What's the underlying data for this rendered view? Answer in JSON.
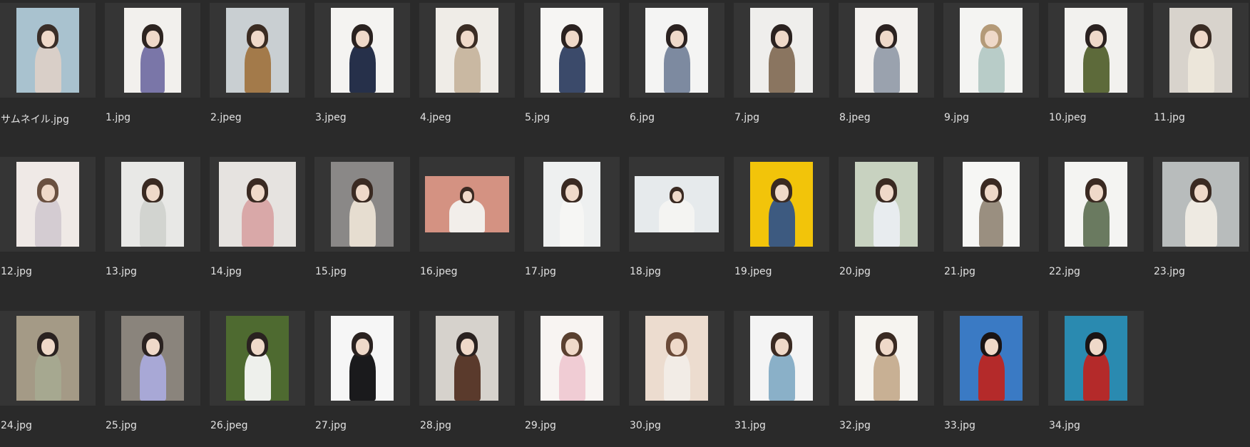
{
  "files": [
    {
      "name": "サムネイル.jpg",
      "orient": "p",
      "bg": "#a9c2cf",
      "fg": "#d9cfc8",
      "hair": "#3a2e28"
    },
    {
      "name": "1.jpg",
      "orient": "ps",
      "bg": "#f2f0ed",
      "fg": "#7a76a8",
      "hair": "#2d2420"
    },
    {
      "name": "2.jpeg",
      "orient": "p",
      "bg": "#c9cfd2",
      "fg": "#a37a4a",
      "hair": "#3b2c22"
    },
    {
      "name": "3.jpeg",
      "orient": "p",
      "bg": "#f4f3f1",
      "fg": "#26304a",
      "hair": "#2a2220"
    },
    {
      "name": "4.jpeg",
      "orient": "p",
      "bg": "#efece7",
      "fg": "#c9b8a2",
      "hair": "#3a2c24"
    },
    {
      "name": "5.jpg",
      "orient": "p",
      "bg": "#f6f5f3",
      "fg": "#3b4a6a",
      "hair": "#2b2220"
    },
    {
      "name": "6.jpg",
      "orient": "p",
      "bg": "#f4f4f3",
      "fg": "#7d8aa0",
      "hair": "#2b2220"
    },
    {
      "name": "7.jpg",
      "orient": "p",
      "bg": "#efeeec",
      "fg": "#8a7560",
      "hair": "#2b2220"
    },
    {
      "name": "8.jpeg",
      "orient": "p",
      "bg": "#f3f1ee",
      "fg": "#9aa2ae",
      "hair": "#2b2220"
    },
    {
      "name": "9.jpg",
      "orient": "p",
      "bg": "#f4f4f2",
      "fg": "#b8ccc8",
      "hair": "#b49a78"
    },
    {
      "name": "10.jpeg",
      "orient": "p",
      "bg": "#f2f1ee",
      "fg": "#5d6a3a",
      "hair": "#2b2220"
    },
    {
      "name": "11.jpg",
      "orient": "p",
      "bg": "#d8d3cc",
      "fg": "#ece6da",
      "hair": "#3a2c24"
    },
    {
      "name": "12.jpg",
      "orient": "p",
      "bg": "#efe9e6",
      "fg": "#d4ccd2",
      "hair": "#6a5040"
    },
    {
      "name": "13.jpg",
      "orient": "p",
      "bg": "#e8e8e6",
      "fg": "#d2d4d0",
      "hair": "#3a2a22"
    },
    {
      "name": "14.jpg",
      "orient": "l",
      "bg": "#e6e3e0",
      "fg": "#d9a8a8",
      "hair": "#3a2a22"
    },
    {
      "name": "15.jpg",
      "orient": "p",
      "bg": "#8a8887",
      "fg": "#e6ddd0",
      "hair": "#3a2a22"
    },
    {
      "name": "16.jpeg",
      "orient": "w",
      "bg": "#d49282",
      "fg": "#f2eeea",
      "hair": "#3a2a22"
    },
    {
      "name": "17.jpg",
      "orient": "ps",
      "bg": "#eef0f0",
      "fg": "#f6f6f4",
      "hair": "#3a2a22"
    },
    {
      "name": "18.jpg",
      "orient": "w",
      "bg": "#e6eaec",
      "fg": "#f4f4f2",
      "hair": "#3a2a22"
    },
    {
      "name": "19.jpeg",
      "orient": "p",
      "bg": "#f2c40a",
      "fg": "#3d5a80",
      "hair": "#3a2a22"
    },
    {
      "name": "20.jpg",
      "orient": "p",
      "bg": "#c8d2c0",
      "fg": "#e8ecef",
      "hair": "#3a2a22"
    },
    {
      "name": "21.jpg",
      "orient": "ps",
      "bg": "#f6f6f4",
      "fg": "#9a8f80",
      "hair": "#3a2a22"
    },
    {
      "name": "22.jpg",
      "orient": "p",
      "bg": "#f4f4f2",
      "fg": "#6a7a60",
      "hair": "#3a2a22"
    },
    {
      "name": "23.jpg",
      "orient": "l",
      "bg": "#b8bcbc",
      "fg": "#eeeae2",
      "hair": "#3a2a22"
    },
    {
      "name": "24.jpg",
      "orient": "p",
      "bg": "#a49a86",
      "fg": "#a6a890",
      "hair": "#2a2220"
    },
    {
      "name": "25.jpg",
      "orient": "p",
      "bg": "#8a847c",
      "fg": "#a8a8d6",
      "hair": "#2a2220"
    },
    {
      "name": "26.jpeg",
      "orient": "p",
      "bg": "#4e6a30",
      "fg": "#eef0ec",
      "hair": "#2a2220"
    },
    {
      "name": "27.jpg",
      "orient": "p",
      "bg": "#f6f6f6",
      "fg": "#1a1a1c",
      "hair": "#2a2220"
    },
    {
      "name": "28.jpg",
      "orient": "p",
      "bg": "#d6d2cc",
      "fg": "#5a3a2c",
      "hair": "#2a2220"
    },
    {
      "name": "29.jpg",
      "orient": "p",
      "bg": "#f8f4f2",
      "fg": "#f0ccd4",
      "hair": "#5a4030"
    },
    {
      "name": "30.jpg",
      "orient": "p",
      "bg": "#ecdccf",
      "fg": "#f2ece6",
      "hair": "#6a4a38"
    },
    {
      "name": "31.jpg",
      "orient": "p",
      "bg": "#f4f4f4",
      "fg": "#8ab0c8",
      "hair": "#3a2a22"
    },
    {
      "name": "32.jpg",
      "orient": "p",
      "bg": "#f6f4f0",
      "fg": "#c8b094",
      "hair": "#3a2a22"
    },
    {
      "name": "33.jpg",
      "orient": "p",
      "bg": "#3a7ac4",
      "fg": "#b42a2a",
      "hair": "#1a1414"
    },
    {
      "name": "34.jpg",
      "orient": "p",
      "bg": "#2a8ab0",
      "fg": "#b42a2a",
      "hair": "#1a1414"
    }
  ]
}
